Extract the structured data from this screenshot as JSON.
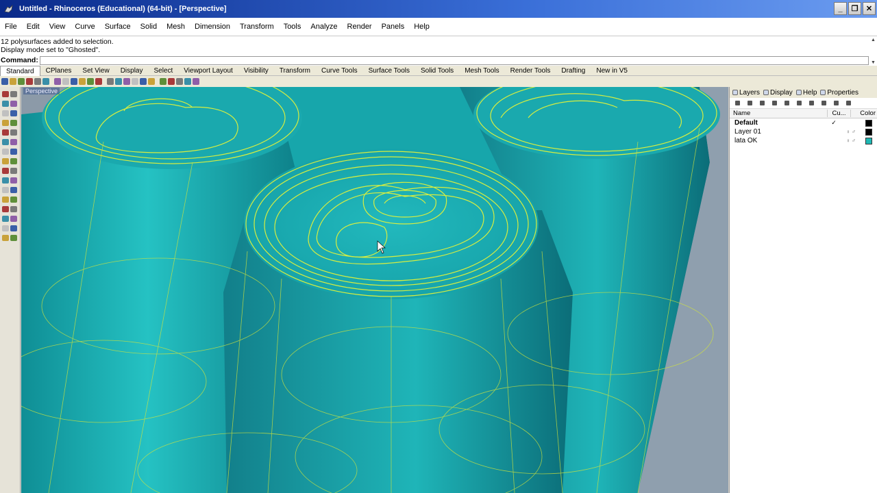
{
  "window": {
    "title": "Untitled - Rhinoceros (Educational) (64-bit) - [Perspective]",
    "controls": {
      "minimize": "_",
      "restore": "❐",
      "close": "✕"
    }
  },
  "menu": [
    "File",
    "Edit",
    "View",
    "Curve",
    "Surface",
    "Solid",
    "Mesh",
    "Dimension",
    "Transform",
    "Tools",
    "Analyze",
    "Render",
    "Panels",
    "Help"
  ],
  "command": {
    "history": [
      "12 polysurfaces added to selection.",
      "Display mode set to \"Ghosted\"."
    ],
    "prompt": "Command:",
    "value": ""
  },
  "toolbar_tabs": {
    "active": "Standard",
    "items": [
      "Standard",
      "CPlanes",
      "Set View",
      "Display",
      "Select",
      "Viewport Layout",
      "Visibility",
      "Transform",
      "Curve Tools",
      "Surface Tools",
      "Solid Tools",
      "Mesh Tools",
      "Render Tools",
      "Drafting",
      "New in V5"
    ]
  },
  "viewport": {
    "label": "Perspective",
    "display_mode": "Ghosted",
    "surface_color": "#19b2b6",
    "wire_color": "#e4f23a",
    "background_color": "#8c9aa8"
  },
  "panel": {
    "tabs": [
      "Layers",
      "Display",
      "Help",
      "Properties"
    ],
    "columns": {
      "name": "Name",
      "current": "Cu...",
      "color": "Color"
    },
    "layers": [
      {
        "name": "Default",
        "current": "✓",
        "flags": "",
        "color": "#000000"
      },
      {
        "name": "Layer 01",
        "current": "",
        "flags": "♀ ♂",
        "color": "#000000"
      },
      {
        "name": "lata OK",
        "current": "",
        "flags": "♀ ♂",
        "color": "#1fb8b4"
      }
    ]
  },
  "icons": {
    "title": "rhino-app-icon",
    "toolbar": [
      "new-icon",
      "open-icon",
      "save-icon",
      "print-icon",
      "import-icon",
      "cut-icon",
      "copy-icon",
      "paste-icon",
      "undo-icon",
      "redo-icon",
      "pan-icon",
      "rotate-icon",
      "zoom-icon",
      "zoom-window-icon",
      "zoom-extents-icon",
      "zoom-selected-icon",
      "grid-icon",
      "select-icon",
      "lights-icon",
      "render-icon",
      "materials-icon",
      "options-icon",
      "help-icon"
    ]
  }
}
